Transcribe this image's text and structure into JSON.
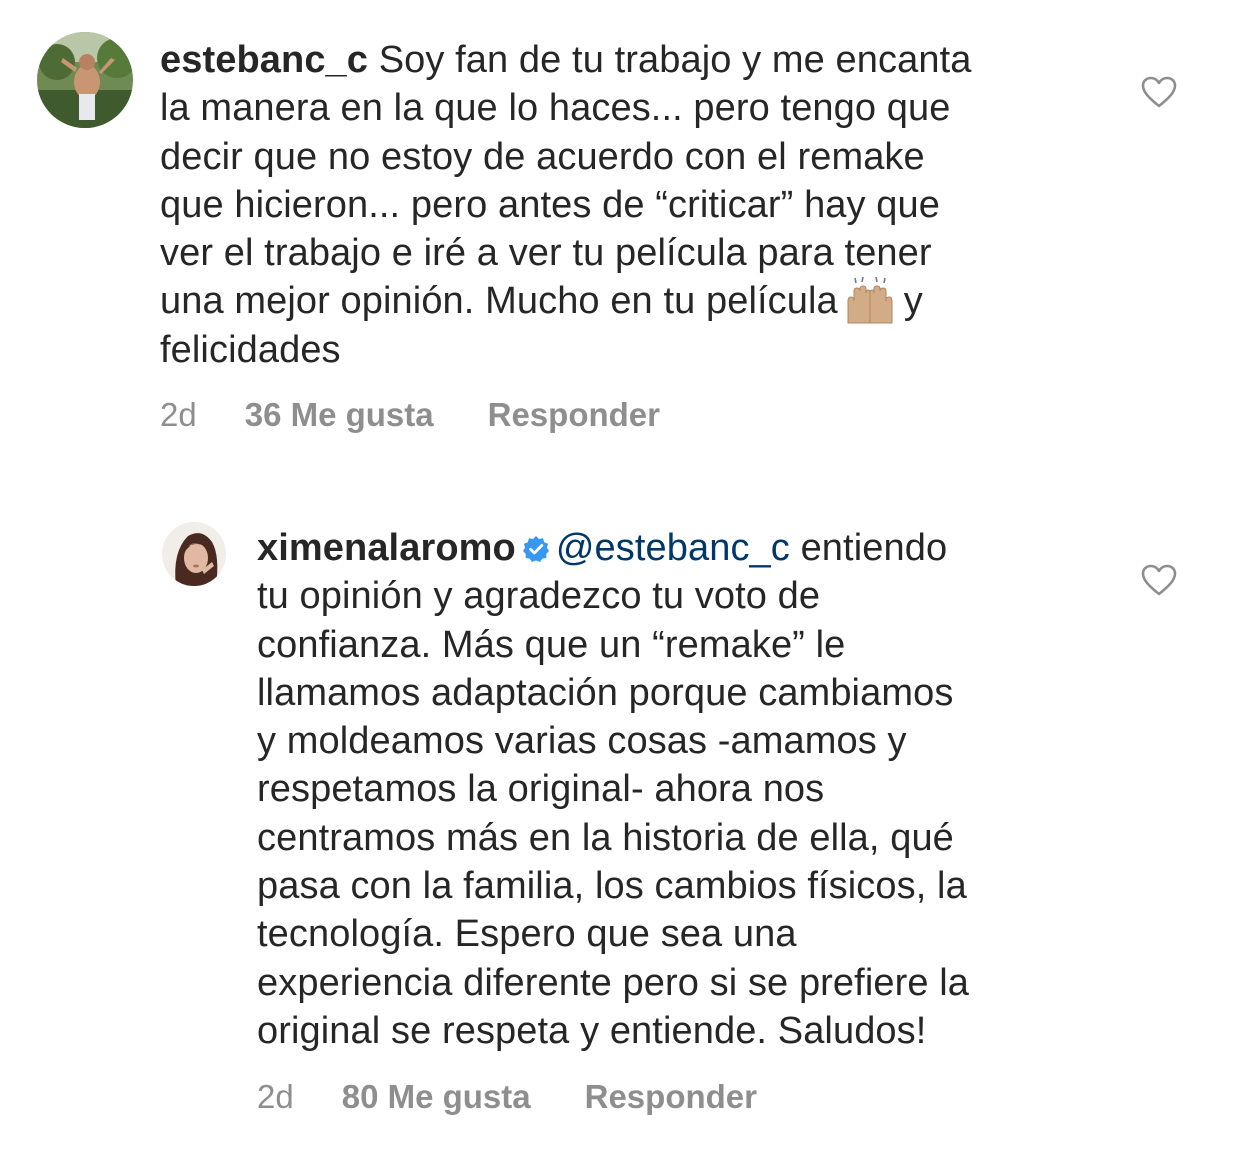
{
  "comments": [
    {
      "username": "estebanc_c",
      "text_lines": [
        "Soy fan de tu trabajo y me encanta",
        "la manera en la que lo haces... pero tengo que",
        "decir que no estoy de acuerdo con el remake",
        "que hicieron... pero antes de “criticar” hay que",
        "ver el trabajo e iré a ver tu película para tener",
        "una mejor opinión. Mucho en tu película",
        "felicidades"
      ],
      "emoji": "🙌🏼",
      "emoji_name": "raising-hands-emoji",
      "after_emoji": "y",
      "time": "2d",
      "likes": "36 Me gusta",
      "reply": "Responder"
    },
    {
      "username": "ximenalaromo",
      "verified": true,
      "mention": "@estebanc_c",
      "text_lines": [
        "entiendo",
        "tu opinión y agradezco tu voto de",
        "confianza. Más que un “remake” le",
        "llamamos adaptación porque cambiamos",
        "y moldeamos varias cosas -amamos y",
        "respetamos la original- ahora nos",
        "centramos más en la historia de ella, qué",
        "pasa con la familia, los cambios físicos, la",
        "tecnología. Espero que sea una",
        "experiencia diferente pero si se prefiere la",
        "original se respeta y entiende. Saludos!"
      ],
      "time": "2d",
      "likes": "80 Me gusta",
      "reply": "Responder"
    }
  ],
  "colors": {
    "text": "#262626",
    "meta": "#8e8e8e",
    "mention": "#00376b",
    "verified": "#3897f0"
  },
  "icons": {
    "like": "heart-outline-icon",
    "verified": "verified-badge-icon"
  }
}
